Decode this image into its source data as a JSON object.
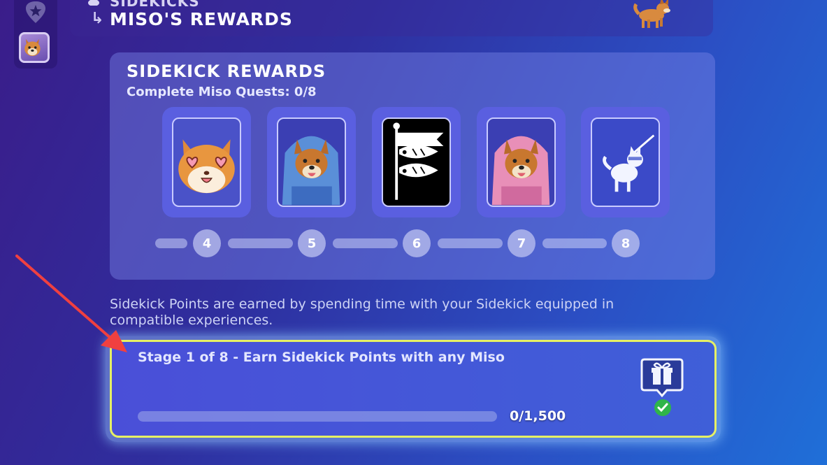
{
  "header": {
    "breadcrumb_parent": "SIDEKICKS",
    "breadcrumb_arrow": "↳",
    "title": "MISO'S REWARDS"
  },
  "rewards": {
    "title": "SIDEKICK REWARDS",
    "subtitle": "Complete Miso Quests: 0/8",
    "items": [
      {
        "icon": "heart-eyes-emoticon-icon"
      },
      {
        "icon": "blue-hoodie-outfit-icon"
      },
      {
        "icon": "koinobori-fish-banner-icon"
      },
      {
        "icon": "pink-hoodie-outfit-icon"
      },
      {
        "icon": "ninja-dog-emote-icon"
      }
    ],
    "steps": [
      "4",
      "5",
      "6",
      "7",
      "8"
    ]
  },
  "info_text": "Sidekick Points are earned by spending time with your Sidekick equipped in compatible experiences.",
  "stage": {
    "title": "Stage 1 of 8 - Earn Sidekick Points with any Miso",
    "progress_text": "0/1,500",
    "progress_fraction": 0.0,
    "reward_icon": "gift-icon",
    "status_icon": "check-icon"
  },
  "colors": {
    "accent_outline": "#e6f064",
    "annotation_arrow": "#f04040",
    "check_green": "#2fb54a"
  }
}
